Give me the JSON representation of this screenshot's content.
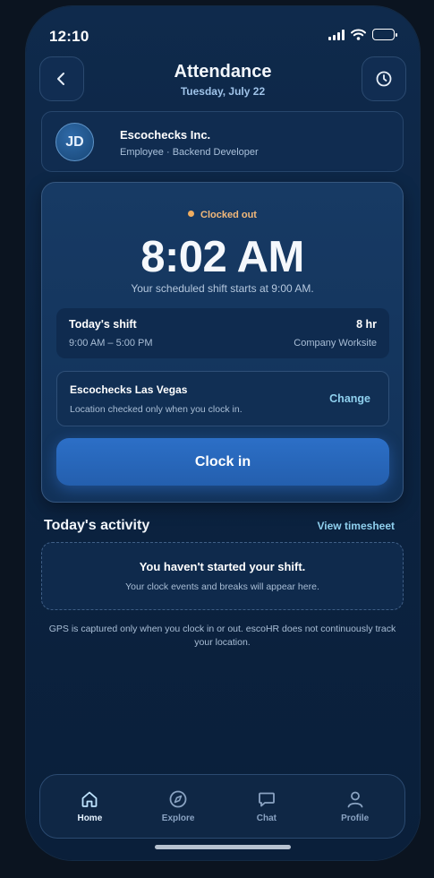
{
  "status_bar": {
    "time": "12:10",
    "icons": [
      "signal-icon",
      "wifi-icon",
      "battery-icon"
    ]
  },
  "header": {
    "title": "Attendance",
    "date": "Tuesday, July 22",
    "back_icon": "chevron-left-icon",
    "history_icon": "clock-icon"
  },
  "employee": {
    "initials": "JD",
    "company": "Escochecks Inc.",
    "role": "Employee · Backend Developer"
  },
  "clock_card": {
    "status": "Clocked out",
    "status_color": "#f0ad60",
    "current_time": "8:02 AM",
    "shift_note": "Your scheduled shift starts at 9:00 AM.",
    "shift": {
      "title": "Today's shift",
      "duration": "8 hr",
      "time_range": "9:00 AM – 5:00 PM",
      "location_type": "Company Worksite"
    },
    "location": {
      "name": "Escochecks Las Vegas",
      "note": "Location checked only when you clock in.",
      "change_label": "Change"
    },
    "clock_in_label": "Clock in",
    "accent_color": "#2c6fc7"
  },
  "activity": {
    "title": "Today's activity",
    "view_timesheet_label": "View timesheet",
    "empty_title": "You haven't started your shift.",
    "empty_subtitle": "Your clock events and breaks will appear here."
  },
  "gps_note": "GPS is captured only when you clock in or out. escoHR does not continuously track your location.",
  "tabbar": {
    "items": [
      {
        "label": "Home",
        "icon": "home-icon",
        "active": true
      },
      {
        "label": "Explore",
        "icon": "compass-icon",
        "active": false
      },
      {
        "label": "Chat",
        "icon": "chat-icon",
        "active": false
      },
      {
        "label": "Profile",
        "icon": "user-icon",
        "active": false
      }
    ]
  }
}
